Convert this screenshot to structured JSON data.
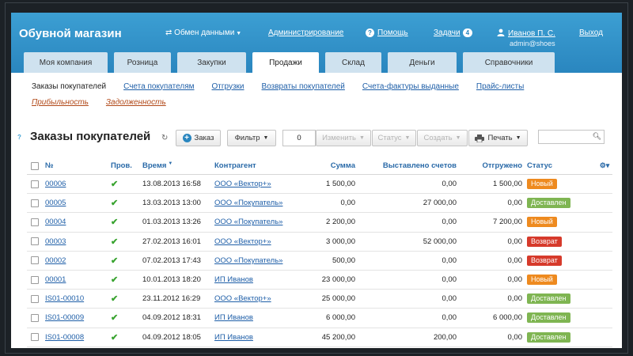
{
  "app": {
    "title": "Обувной магазин"
  },
  "topnav": {
    "exchange": "Обмен данными",
    "admin": "Администрирование",
    "help": "Помощь",
    "tasks": "Задачи",
    "tasks_count": "4",
    "user_name": "Иванов П. С.",
    "user_login": "admin@shoes",
    "logout": "Выход"
  },
  "tabs": [
    {
      "label": "Моя компания"
    },
    {
      "label": "Розница"
    },
    {
      "label": "Закупки"
    },
    {
      "label": "Продажи"
    },
    {
      "label": "Склад"
    },
    {
      "label": "Деньги"
    },
    {
      "label": "Справочники"
    }
  ],
  "subnav": {
    "row1": [
      "Заказы покупателей",
      "Счета покупателям",
      "Отгрузки",
      "Возвраты покупателей",
      "Счета-фактуры выданные",
      "Прайс-листы"
    ],
    "row2": [
      "Прибыльность",
      "Задолженность"
    ]
  },
  "toolbar": {
    "title": "Заказы покупателей",
    "add_label": "Заказ",
    "filter_label": "Фильтр",
    "selected_count": "0",
    "edit_label": "Изменить",
    "status_label": "Статус",
    "create_label": "Создать",
    "print_label": "Печать",
    "search_value": ""
  },
  "table": {
    "headers": {
      "num": "№",
      "prov": "Пров.",
      "time": "Время",
      "kontr": "Контрагент",
      "sum": "Сумма",
      "vyst": "Выставлено счетов",
      "otgr": "Отгружено",
      "status": "Статус"
    },
    "rows": [
      {
        "num": "00006",
        "time": "13.08.2013 16:58",
        "kontr": "ООО «Вектор+»",
        "sum": "1 500,00",
        "vyst": "0,00",
        "otgr": "1 500,00",
        "status": "Новый"
      },
      {
        "num": "00005",
        "time": "13.03.2013 13:00",
        "kontr": "ООО «Покупатель»",
        "sum": "0,00",
        "vyst": "27 000,00",
        "otgr": "0,00",
        "status": "Доставлен"
      },
      {
        "num": "00004",
        "time": "01.03.2013 13:26",
        "kontr": "ООО «Покупатель»",
        "sum": "2 200,00",
        "vyst": "0,00",
        "otgr": "7 200,00",
        "status": "Новый"
      },
      {
        "num": "00003",
        "time": "27.02.2013 16:01",
        "kontr": "ООО «Вектор+»",
        "sum": "3 000,00",
        "vyst": "52 000,00",
        "otgr": "0,00",
        "status": "Возврат"
      },
      {
        "num": "00002",
        "time": "07.02.2013 17:43",
        "kontr": "ООО «Покупатель»",
        "sum": "500,00",
        "vyst": "0,00",
        "otgr": "0,00",
        "status": "Возврат"
      },
      {
        "num": "00001",
        "time": "10.01.2013 18:20",
        "kontr": "ИП Иванов",
        "sum": "23 000,00",
        "vyst": "0,00",
        "otgr": "0,00",
        "status": "Новый"
      },
      {
        "num": "IS01-00010",
        "time": "23.11.2012 16:29",
        "kontr": "ООО «Вектор+»",
        "sum": "25 000,00",
        "vyst": "0,00",
        "otgr": "0,00",
        "status": "Доставлен"
      },
      {
        "num": "IS01-00009",
        "time": "04.09.2012 18:31",
        "kontr": "ИП Иванов",
        "sum": "6 000,00",
        "vyst": "0,00",
        "otgr": "6 000,00",
        "status": "Доставлен"
      },
      {
        "num": "IS01-00008",
        "time": "04.09.2012 18:05",
        "kontr": "ИП Иванов",
        "sum": "45 200,00",
        "vyst": "200,00",
        "otgr": "0,00",
        "status": "Доставлен"
      }
    ]
  },
  "colors": {
    "header_blue": "#2a86bf",
    "status_new": "#ee8a1f",
    "status_delivered": "#7fb552",
    "status_return": "#d63a2b",
    "check_green": "#38a32f"
  }
}
